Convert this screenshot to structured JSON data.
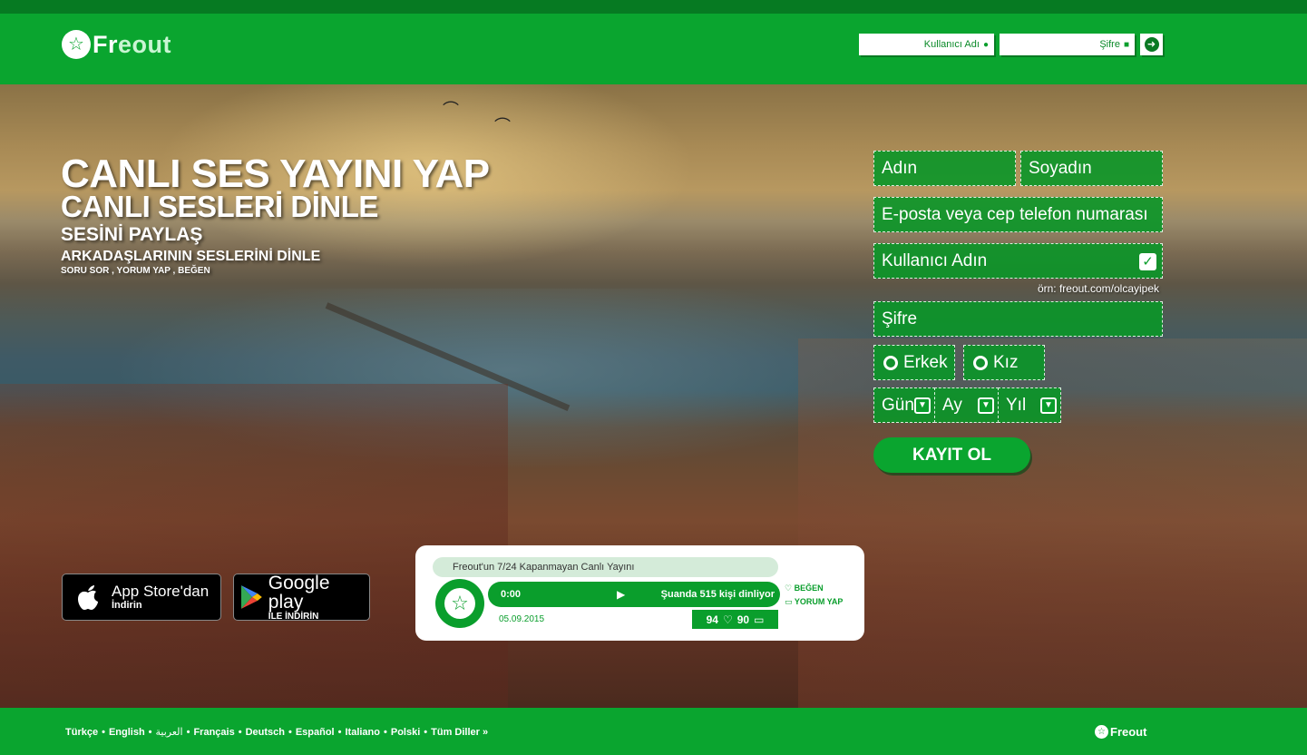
{
  "header": {
    "logo_text_part1": "Fr",
    "logo_text_part2": "eout",
    "login": {
      "username_placeholder": "Kullanıcı Adı",
      "password_placeholder": "Şifre",
      "submit_icon": "arrow-right-circle-icon"
    }
  },
  "hero": {
    "headline_1": "CANLI SES YAYINI YAP",
    "headline_2": "CANLI SESLERİ DİNLE",
    "headline_3": "SESİNİ PAYLAŞ",
    "headline_4": "ARKADAŞLARININ SESLERİNİ DİNLE",
    "headline_5": "SORU SOR , YORUM YAP , BEĞEN"
  },
  "stores": {
    "apple_line1": "App Store'dan",
    "apple_line2": "İndirin",
    "google_line1": "Google play",
    "google_line2": "İLE İNDİRİN"
  },
  "player": {
    "title": "Freout'un 7/24 Kapanmayan Canlı Yayını",
    "time": "0:00",
    "play_glyph": "▶",
    "listeners": "Şuanda 515 kişi dinliyor",
    "date": "05.09.2015",
    "likes": "94",
    "comments": "90",
    "like_label": "BEĞEN",
    "comment_label": "YORUM YAP"
  },
  "register": {
    "first_name": "Adın",
    "last_name": "Soyadın",
    "email": "E-posta veya cep telefon numarası",
    "username": "Kullanıcı Adın",
    "username_hint": "örn: freout.com/olcayipek",
    "password": "Şifre",
    "gender_male": "Erkek",
    "gender_female": "Kız",
    "day": "Gün",
    "month": "Ay",
    "year": "Yıl",
    "submit": "KAYIT OL"
  },
  "footer": {
    "languages": [
      "Türkçe",
      "English",
      "العربية",
      "Français",
      "Deutsch",
      "Español",
      "Italiano",
      "Polski",
      "Tüm Diller"
    ],
    "logo_text": "Freout"
  },
  "colors": {
    "brand_green": "#0aa52f",
    "dark_green": "#067a22"
  }
}
